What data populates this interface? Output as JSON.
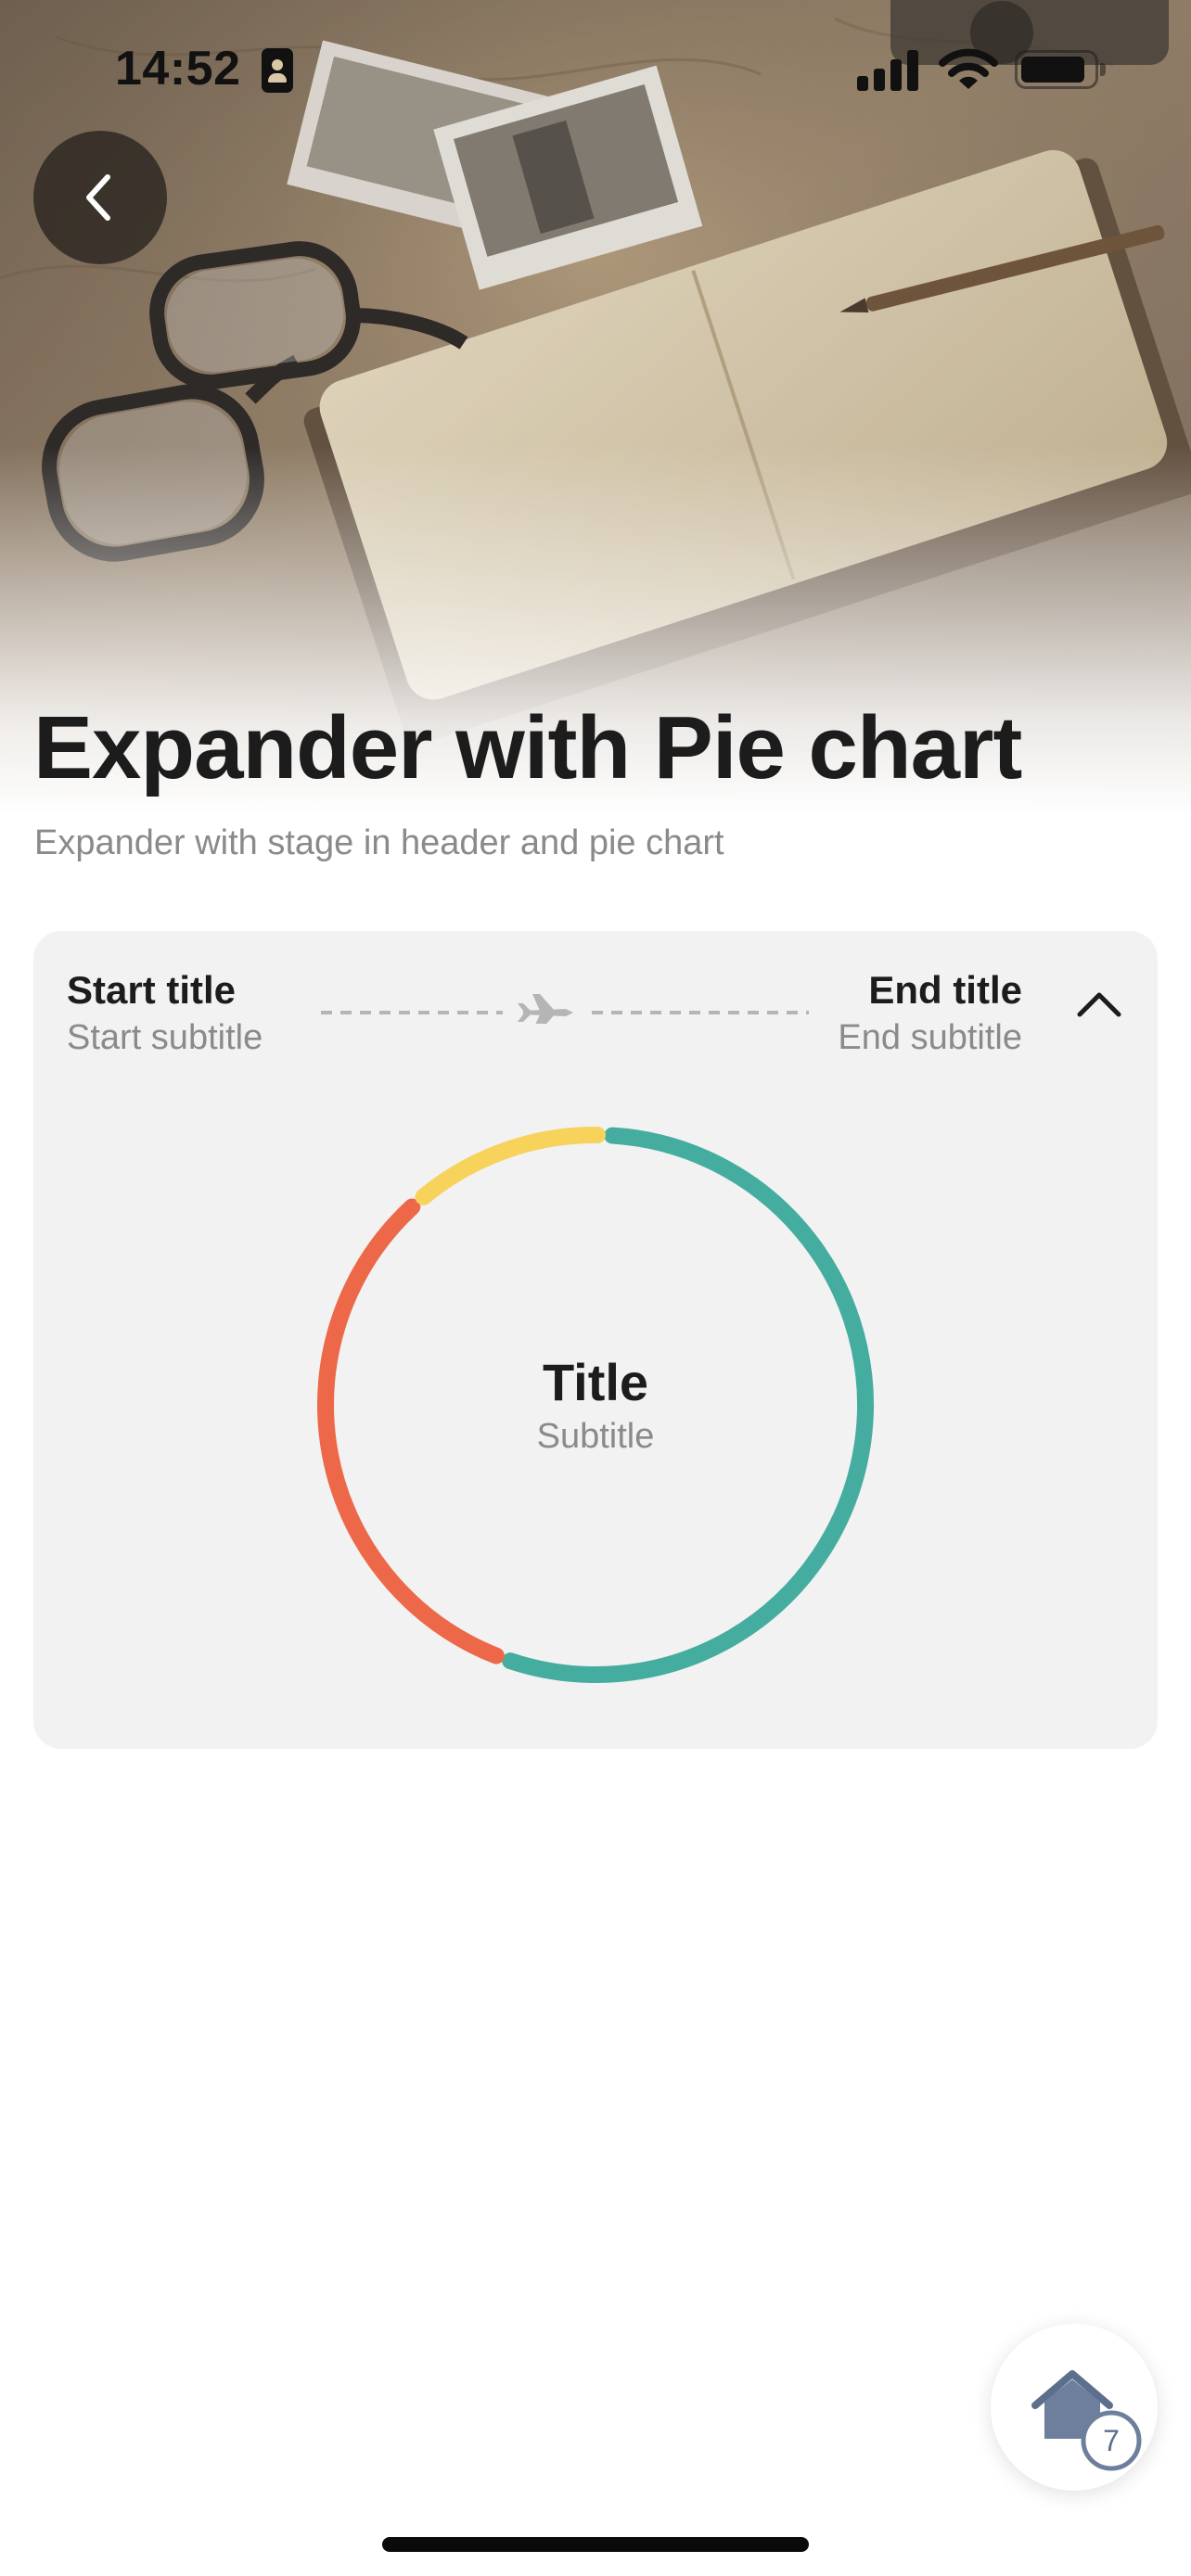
{
  "status_bar": {
    "time": "14:52"
  },
  "header": {
    "back_icon": "chevron-left-icon",
    "title": "Expander with Pie chart",
    "subtitle": "Expander with stage in header and pie chart"
  },
  "card": {
    "start": {
      "title": "Start title",
      "subtitle": "Start subtitle"
    },
    "end": {
      "title": "End title",
      "subtitle": "End subtitle"
    },
    "route_icon": "airplane-icon",
    "toggle_icon": "chevron-up-icon",
    "expanded": true
  },
  "chart_data": {
    "type": "pie",
    "title": "Title",
    "subtitle": "Subtitle",
    "style": "donut",
    "slices": [
      {
        "value": 55,
        "color": "#45ad9f"
      },
      {
        "value": 33,
        "color": "#ed6848"
      },
      {
        "value": 12,
        "color": "#f7d35c"
      }
    ]
  },
  "fab": {
    "icon": "home-icon",
    "badge": "7"
  }
}
